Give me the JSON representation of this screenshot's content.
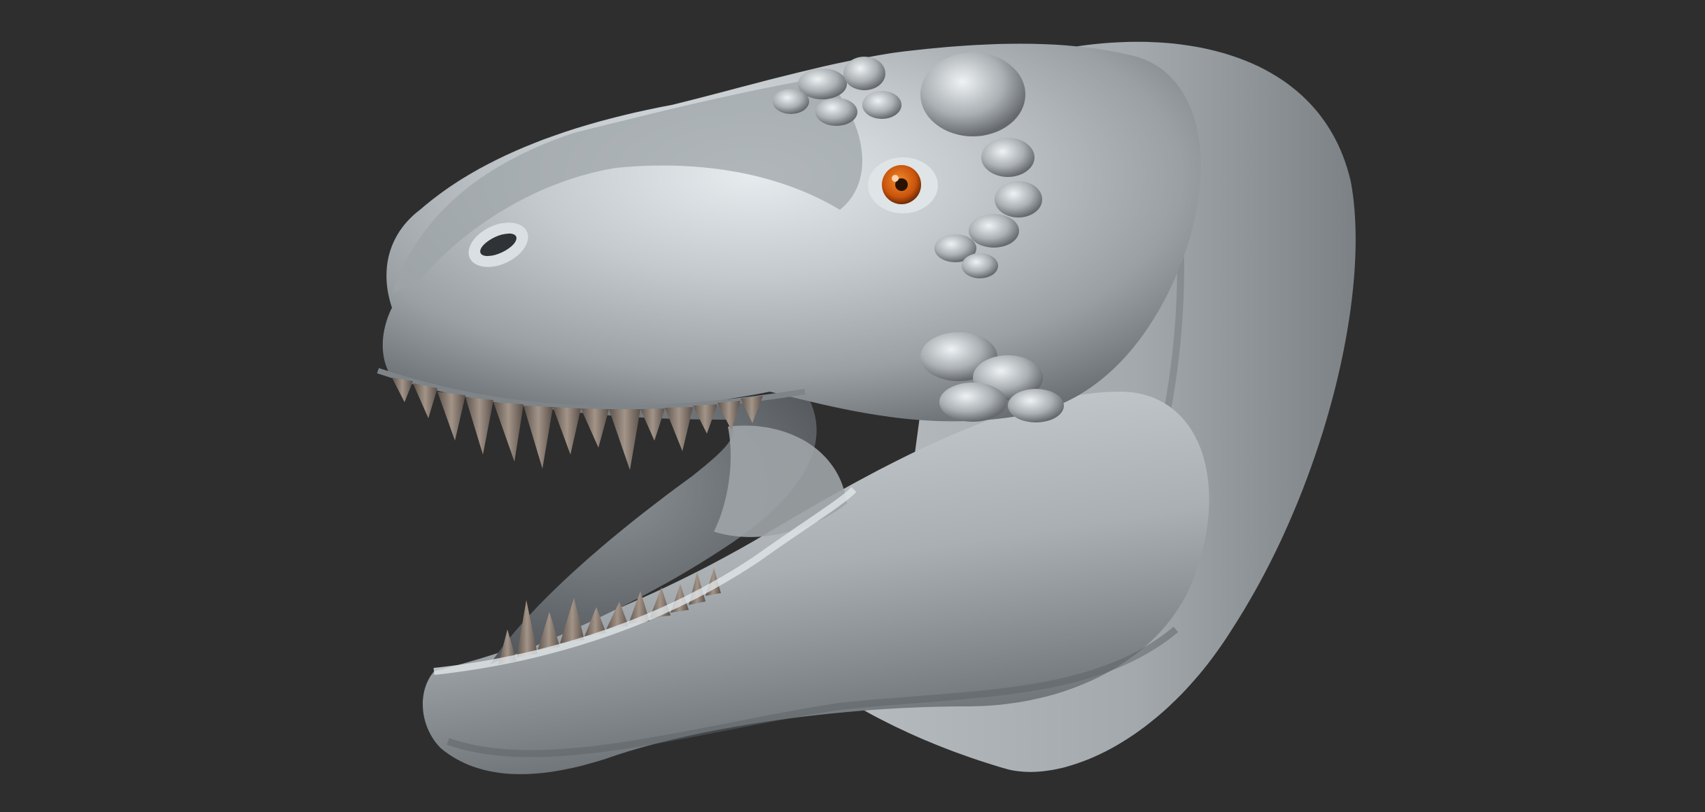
{
  "scene": {
    "subject": "t-rex-head-sculpt",
    "background_color": "#2e2e2e",
    "material_base_color": "#b5bcc0",
    "material_highlight_color": "#e9eef0",
    "material_shadow_color": "#6a7075",
    "eye_iris_color": "#c9540c",
    "teeth_color": "#7d6f65"
  }
}
